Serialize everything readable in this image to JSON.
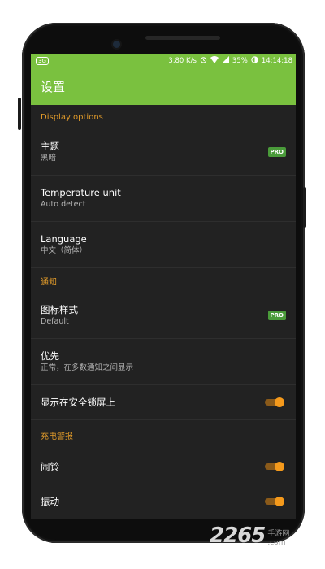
{
  "status_bar": {
    "network_badge": "3G",
    "speed": "3.80 K/s",
    "battery": "35%",
    "time": "14:14:18"
  },
  "app_bar": {
    "title": "设置"
  },
  "sections": {
    "display": "Display options",
    "notifications": "通知",
    "charging": "充电警报"
  },
  "settings": {
    "theme": {
      "title": "主题",
      "value": "黑暗",
      "badge": "PRO"
    },
    "temperature": {
      "title": "Temperature unit",
      "value": "Auto detect"
    },
    "language": {
      "title": "Language",
      "value": "中文（简体）"
    },
    "icon_style": {
      "title": "图标样式",
      "value": "Default",
      "badge": "PRO"
    },
    "priority": {
      "title": "优先",
      "value": "正常，在多数通知之间显示"
    },
    "lockscreen": {
      "title": "显示在安全锁屏上",
      "enabled": true
    },
    "alarm": {
      "title": "闹铃",
      "enabled": true
    },
    "partial": {
      "title": "振动",
      "enabled": true
    }
  },
  "colors": {
    "accent": "#7ac13f",
    "toggle": "#f59a1c",
    "section": "#e09a2a"
  },
  "watermark": {
    "logo": "2265",
    "suffix": ".com",
    "site": "手游网"
  }
}
